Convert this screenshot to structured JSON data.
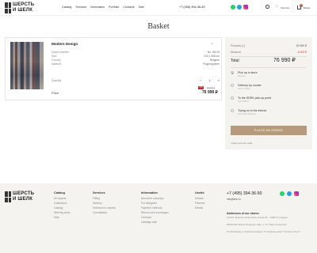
{
  "header": {
    "logo": [
      "ШЕРСТЬ",
      "И ШЕЛК"
    ],
    "nav": [
      "Catalog",
      "Services",
      "Information",
      "Portfolio",
      "Contacts",
      "Sale"
    ],
    "phone": "+7 (495) 394-36-50",
    "favorites_label": "Favorites",
    "basket_label": "Basket",
    "basket_count": "1",
    "icons": [
      "whatsapp-icon",
      "telegram-icon",
      "instagram-icon",
      "search-icon",
      "heart-icon",
      "basket-icon"
    ]
  },
  "page": {
    "title": "Basket"
  },
  "product": {
    "name": "Modern Design",
    "specs": [
      {
        "label": "Carpet number",
        "value": "No. 05175"
      },
      {
        "label": "Size",
        "value": "240 x 336 cm"
      },
      {
        "label": "Country",
        "value": "Belgium"
      },
      {
        "label": "Material",
        "value": "Polypropylene"
      }
    ],
    "quantity_label": "Quantity",
    "quantity": "1",
    "price_label": "Price",
    "discount": "-7%",
    "old_price": "82 990 ₽",
    "price": "76 990 ₽"
  },
  "summary": {
    "products_label": "Products (1)",
    "products_value": "82 990 ₽",
    "discount_label": "Discount",
    "discount_value": "-6 000 ₽",
    "total_label": "Total",
    "total_value": "76 990 ₽",
    "options": [
      {
        "title": "Pick up in store",
        "sub": "For free",
        "selected": true
      },
      {
        "title": "Delivery by courier",
        "sub": "From 1 500 ₽",
        "selected": false
      },
      {
        "title": "To the SDEK pick-up point",
        "sub": "From 500 ₽",
        "selected": false
      },
      {
        "title": "Trying on in the interior",
        "sub": "Free within Moscow",
        "selected": false
      }
    ],
    "order_button": "PLACE AN ORDER",
    "promo_link": "I have a promo code"
  },
  "footer": {
    "columns": [
      {
        "heading": "Catalog",
        "items": [
          "All carpets",
          "Collections",
          "Catalog",
          "With big sizes",
          "Sale"
        ]
      },
      {
        "heading": "Services",
        "items": [
          "Fitting",
          "Delivery",
          "Selection in carpets",
          "Consultation"
        ]
      },
      {
        "heading": "Information",
        "items": [
          "About the company",
          "For designers",
          "Payment methods",
          "Returns and exchanges",
          "Contacts",
          "Catalogs sale"
        ]
      },
      {
        "heading": "Useful",
        "items": [
          "Articles",
          "Partners",
          "Details"
        ]
      }
    ],
    "phone": "+7 (495) 394-36-50",
    "email": "info@sek.ru",
    "addresses_heading": "Addresses of our stores:",
    "addresses": [
      "121471, Moscow, Dmitrovskoe shosse 81, - 1905 TC Lingerie",
      "MOSCOW, Nizhny Novgorod, Lake, 1, TC \"Open Condomist\"",
      "St. Petersburg, st. Kantemirovskaya, TC shopping center \"Furniture City 2\""
    ]
  }
}
